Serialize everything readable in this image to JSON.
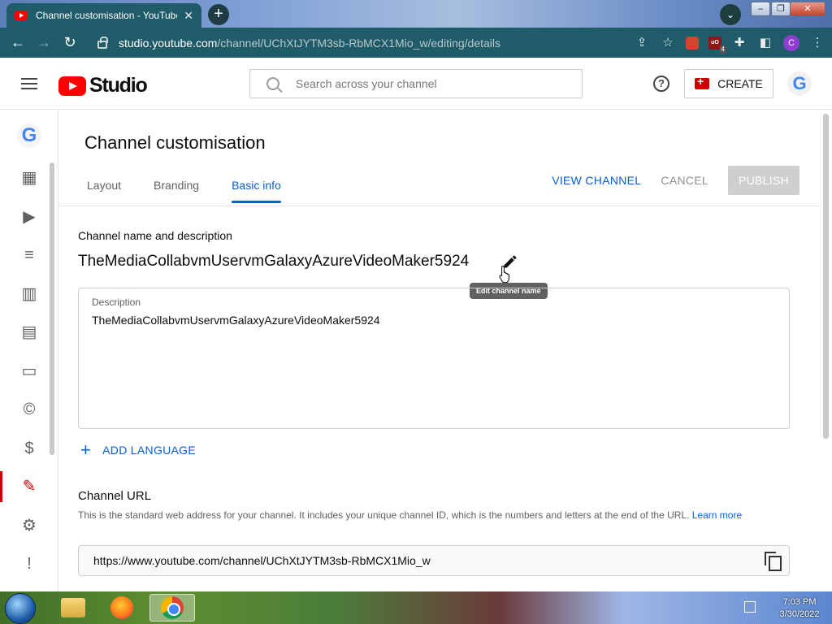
{
  "browser": {
    "tab_title": "Channel customisation - YouTube",
    "tab_close": "✕",
    "new_tab": "+",
    "url_host": "studio.youtube.com",
    "url_path": "/channel/UChXtJYTM3sb-RbMCX1Mio_w/editing/details",
    "profile_initial": "C",
    "ub_badge": "4",
    "ub_label": "uO"
  },
  "header": {
    "logo_text": "Studio",
    "search_placeholder": "Search across your channel",
    "help_label": "?",
    "create_label": "CREATE",
    "avatar_letter": "G"
  },
  "leftnav": {
    "avatar_letter": "G",
    "items": [
      {
        "icon": "dashboard-icon",
        "glyph": "▦"
      },
      {
        "icon": "content-icon",
        "glyph": "▶"
      },
      {
        "icon": "playlists-icon",
        "glyph": "≡"
      },
      {
        "icon": "analytics-icon",
        "glyph": "▥"
      },
      {
        "icon": "comments-icon",
        "glyph": "▤"
      },
      {
        "icon": "subtitles-icon",
        "glyph": "▭"
      },
      {
        "icon": "copyright-icon",
        "glyph": "©"
      },
      {
        "icon": "earn-icon",
        "glyph": "$"
      },
      {
        "icon": "customisation-icon",
        "glyph": "✎",
        "active": true
      },
      {
        "icon": "settings-icon",
        "glyph": "⚙"
      },
      {
        "icon": "feedback-icon",
        "glyph": "!"
      }
    ]
  },
  "main": {
    "page_title": "Channel customisation",
    "tabs": [
      {
        "label": "Layout",
        "active": false
      },
      {
        "label": "Branding",
        "active": false
      },
      {
        "label": "Basic info",
        "active": true
      }
    ],
    "actions": {
      "view_channel": "VIEW CHANNEL",
      "cancel": "CANCEL",
      "publish": "PUBLISH"
    },
    "name_section_label": "Channel name and description",
    "channel_name": "TheMediaCollabvmUservmGalaxyAzureVideoMaker5924",
    "tooltip": "Edit channel name",
    "description_label": "Description",
    "description_value": "TheMediaCollabvmUservmGalaxyAzureVideoMaker5924",
    "add_language": "ADD LANGUAGE",
    "url_title": "Channel URL",
    "url_description": "This is the standard web address for your channel. It includes your unique channel ID, which is the numbers and letters at the end of the URL.",
    "learn_more": "Learn more",
    "channel_url": "https://www.youtube.com/channel/UChXtJYTM3sb-RbMCX1Mio_w"
  },
  "taskbar": {
    "time": "7:03 PM",
    "date": "3/30/2022"
  },
  "colors": {
    "accent_blue": "#065fd4",
    "brand_red": "#ff0000",
    "chrome_toolbar": "#1f5b68"
  }
}
